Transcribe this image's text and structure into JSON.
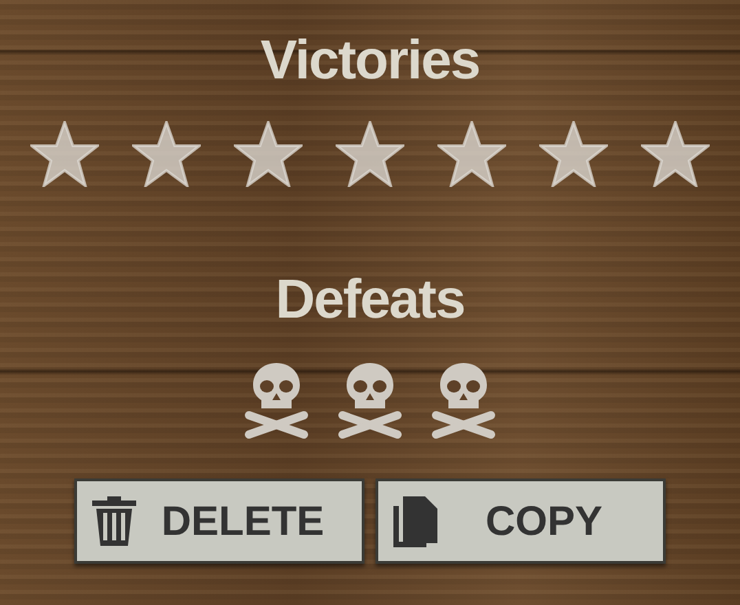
{
  "victories": {
    "title": "Victories",
    "stars": 7
  },
  "defeats": {
    "title": "Defeats",
    "marks": [
      {
        "kind": "skull"
      },
      {
        "kind": "skull"
      },
      {
        "kind": "skull"
      }
    ]
  },
  "buttons": [
    {
      "kind": "delete",
      "label": "DELETE"
    },
    {
      "kind": "copy",
      "label": "COPY"
    }
  ]
}
